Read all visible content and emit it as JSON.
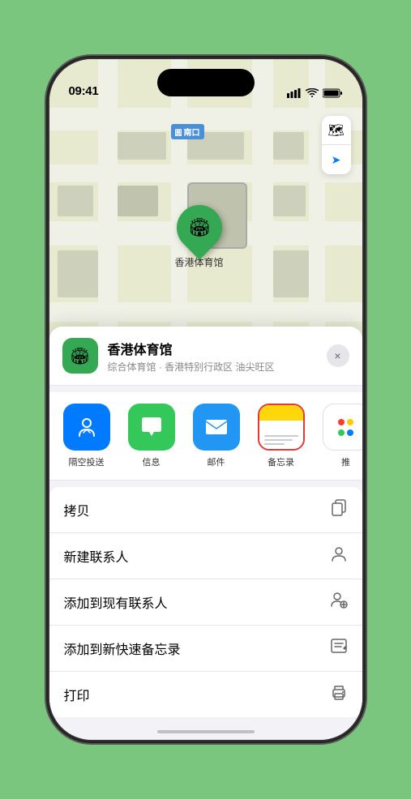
{
  "status_bar": {
    "time": "09:41",
    "signal_bars": "▌▌▌",
    "wifi": "wifi",
    "battery": "battery"
  },
  "map": {
    "label": "南口",
    "controls": {
      "layers_icon": "🗺",
      "location_icon": "➤"
    },
    "pin_label": "香港体育馆",
    "pin_emoji": "🏟"
  },
  "venue": {
    "name": "香港体育馆",
    "desc": "综合体育馆 · 香港特别行政区 油尖旺区",
    "icon_emoji": "🏟"
  },
  "share_actions": [
    {
      "id": "airdrop",
      "label": "隔空投送"
    },
    {
      "id": "messages",
      "label": "信息"
    },
    {
      "id": "mail",
      "label": "邮件"
    },
    {
      "id": "notes",
      "label": "备忘录"
    },
    {
      "id": "more",
      "label": "推"
    }
  ],
  "menu_items": [
    {
      "label": "拷贝",
      "icon": "copy"
    },
    {
      "label": "新建联系人",
      "icon": "person"
    },
    {
      "label": "添加到现有联系人",
      "icon": "person-add"
    },
    {
      "label": "添加到新快速备忘录",
      "icon": "note"
    },
    {
      "label": "打印",
      "icon": "print"
    }
  ],
  "close_button_label": "×"
}
